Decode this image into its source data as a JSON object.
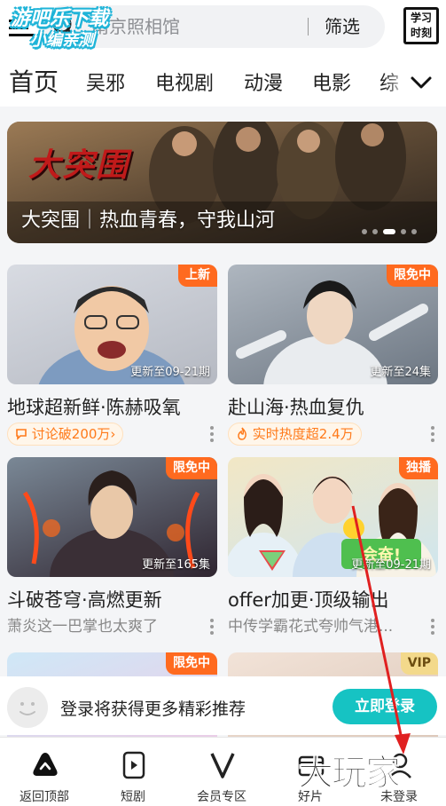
{
  "header": {
    "search_placeholder": "南京照相馆",
    "filter_label": "筛选",
    "study_icon_text": [
      "学习",
      "时刻"
    ],
    "watermark_lines": [
      "游吧乐下载",
      "小编亲测"
    ]
  },
  "tabs": [
    "首页",
    "吴邪",
    "电视剧",
    "动漫",
    "电影",
    "综"
  ],
  "active_tab": "首页",
  "banner": {
    "logo_text": "大突围",
    "caption": "大突围｜热血青春，守我山河",
    "dot_count": 5,
    "active_dot": 3
  },
  "cards": [
    {
      "badge": "上新",
      "episode": "更新至09-21期",
      "title": "地球超新鲜·陈赫吸氧",
      "tag_icon": "chat-bubble-icon",
      "tag": "讨论破200万",
      "tag_suffix": "›"
    },
    {
      "badge": "限免中",
      "episode": "更新至24集",
      "title": "赴山海·热血复仇",
      "tag_icon": "flame-icon",
      "tag": "实时热度超2.4万"
    },
    {
      "badge": "限免中",
      "episode": "更新至165集",
      "title": "斗破苍穹·高燃更新",
      "subtitle": "萧炎这一巴掌也太爽了"
    },
    {
      "badge": "独播",
      "episode": "更新至09-21期",
      "title": "offer加更·顶级输出",
      "subtitle": "中传学霸花式夸帅气港...",
      "sticker": "会奋!"
    },
    {
      "badge": "限免中"
    },
    {
      "badge": "VIP"
    }
  ],
  "login_bar": {
    "text": "登录将获得更多精彩推荐",
    "button": "立即登录"
  },
  "bottom_nav": [
    {
      "label": "返回顶部",
      "icon": "home-top-icon"
    },
    {
      "label": "短剧",
      "icon": "short-drama-icon"
    },
    {
      "label": "会员专区",
      "icon": "vip-v-icon"
    },
    {
      "label": "好片",
      "icon": "film-icon"
    },
    {
      "label": "未登录",
      "icon": "user-icon"
    }
  ],
  "overlay_watermark": "大玩家",
  "colors": {
    "accent": "#16c3c3",
    "badge_orange": "#ff6a1f",
    "vip_gold": "#f3d98b",
    "tag_orange": "#ff7a1a",
    "annotation_red": "#e02020"
  }
}
